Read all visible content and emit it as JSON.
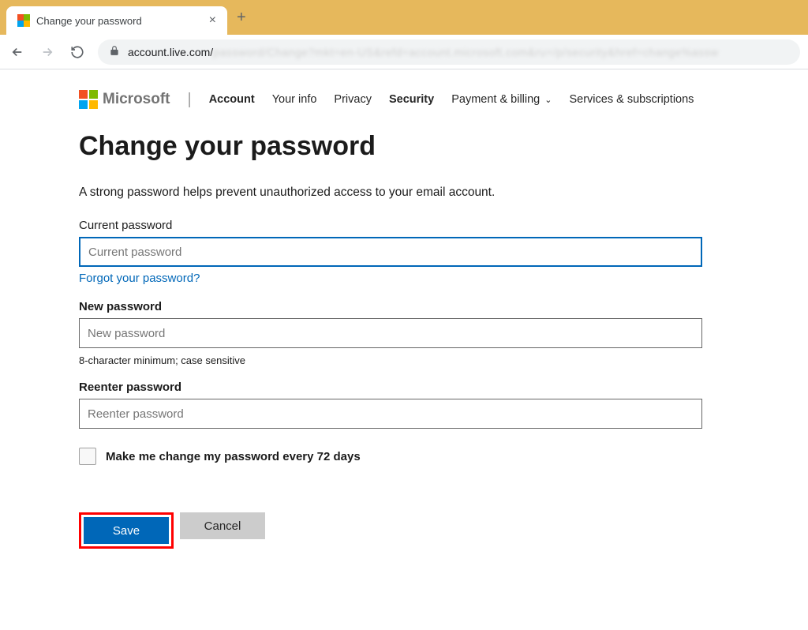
{
  "browser": {
    "tab_title": "Change your password",
    "url_prefix": "account.live.com/",
    "url_suffix_blurred": "password/Change?mkt=en-US&refd=account.microsoft.com&ru=/p/security&href=change%assw"
  },
  "header": {
    "brand": "Microsoft",
    "nav": {
      "account": "Account",
      "your_info": "Your info",
      "privacy": "Privacy",
      "security": "Security",
      "payment": "Payment & billing",
      "services": "Services & subscriptions"
    }
  },
  "main": {
    "title": "Change your password",
    "subtitle": "A strong password helps prevent unauthorized access to your email account.",
    "current_password": {
      "label": "Current password",
      "placeholder": "Current password",
      "forgot_link": "Forgot your password?"
    },
    "new_password": {
      "label": "New password",
      "placeholder": "New password",
      "hint": "8-character minimum; case sensitive"
    },
    "reenter_password": {
      "label": "Reenter password",
      "placeholder": "Reenter password"
    },
    "checkbox_label": "Make me change my password every 72 days",
    "save_label": "Save",
    "cancel_label": "Cancel"
  }
}
